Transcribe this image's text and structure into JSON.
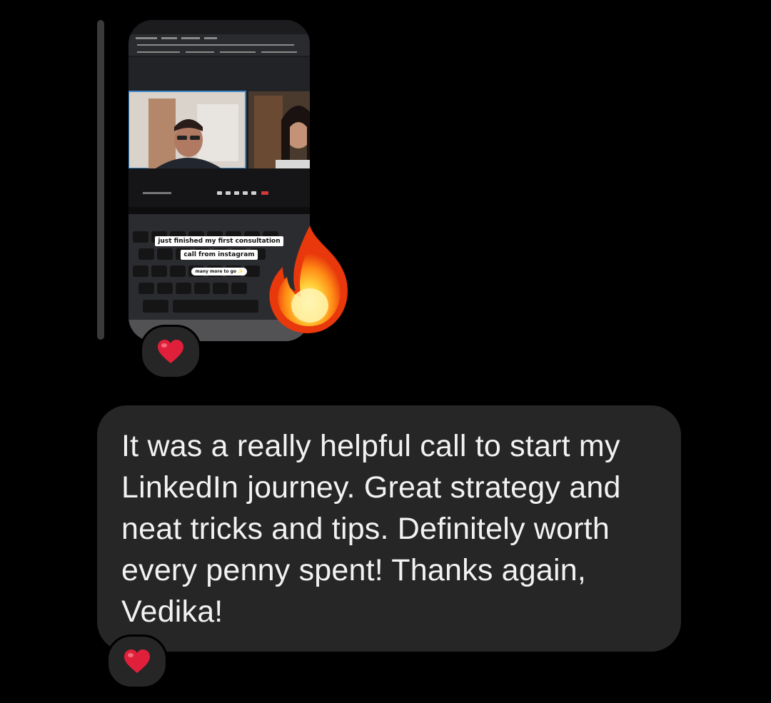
{
  "story": {
    "caption_line_1": "just finished my first consultation",
    "caption_line_2": "call from instagram",
    "caption_sticker": "many more to go ✨",
    "sticker_icon": "fire-icon"
  },
  "reactions": [
    {
      "icon": "heart-icon",
      "emoji": "❤️"
    },
    {
      "icon": "heart-icon",
      "emoji": "❤️"
    }
  ],
  "message": {
    "text": "It was a really helpful call to start my LinkedIn journey. Great strategy and neat tricks and tips. Definitely worth every penny spent! Thanks again, Vedika!"
  },
  "colors": {
    "background": "#000000",
    "bubble": "#262626",
    "text": "#f2f2f2",
    "heart": "#e0203a"
  }
}
